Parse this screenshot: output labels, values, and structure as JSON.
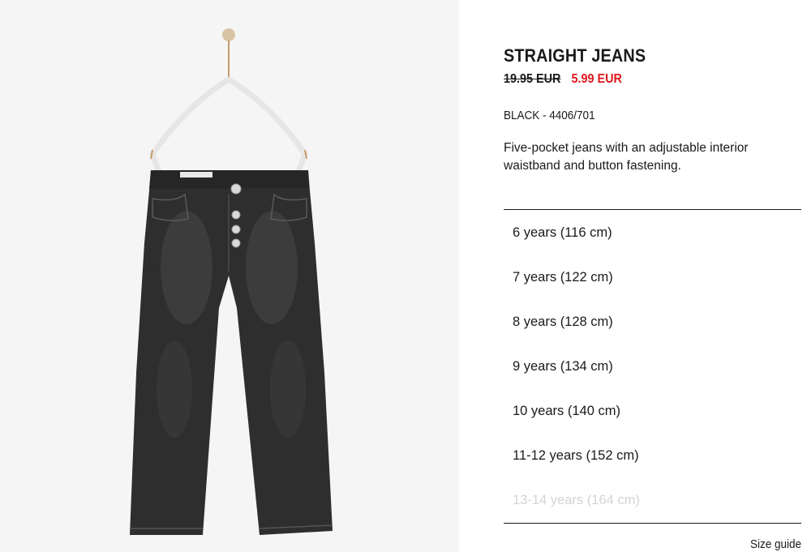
{
  "product": {
    "name": "STRAIGHT JEANS",
    "old_price": "19.95 EUR",
    "sale_price": "5.99 EUR",
    "color_ref": "BLACK - 4406/701",
    "description": "Five-pocket jeans with an adjustable interior waistband and button fastening."
  },
  "sizes": [
    {
      "label": "6 years (116 cm)",
      "available": true
    },
    {
      "label": "7 years (122 cm)",
      "available": true
    },
    {
      "label": "8 years (128 cm)",
      "available": true
    },
    {
      "label": "9 years (134 cm)",
      "available": true
    },
    {
      "label": "10 years (140 cm)",
      "available": true
    },
    {
      "label": "11-12 years (152 cm)",
      "available": true
    },
    {
      "label": "13-14 years (164 cm)",
      "available": false
    }
  ],
  "size_guide_label": "Size guide",
  "colors": {
    "sale_red": "#e0161b",
    "denim": "#2e2e2e",
    "image_bg": "#f5f5f5"
  },
  "icons": {
    "product_image": "black-straight-jeans-on-hanger"
  }
}
